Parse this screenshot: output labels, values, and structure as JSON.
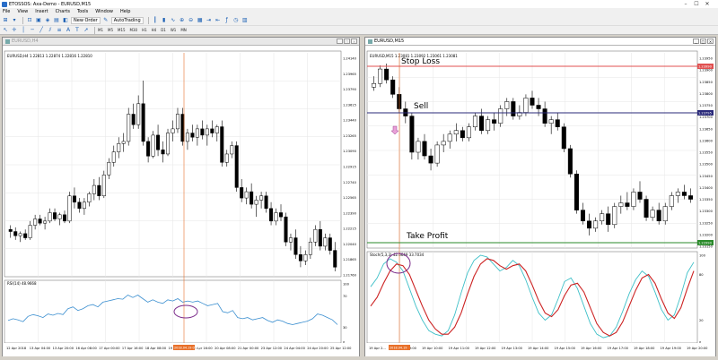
{
  "window": {
    "title": "ETOSSOS: Axa-Demo - EURUSD,M15",
    "min": "–",
    "max": "☐",
    "close": "✕"
  },
  "menu": [
    "File",
    "View",
    "Insert",
    "Charts",
    "Tools",
    "Window",
    "Help"
  ],
  "toolbar": {
    "new_order": "New Order",
    "auto_trading": "AutoTrading"
  },
  "timeframes": [
    "M1",
    "M5",
    "M15",
    "M30",
    "H1",
    "H4",
    "D1",
    "W1",
    "MN"
  ],
  "left_chart": {
    "tab": "EURUSD,H4",
    "info": "EURUSD,H4 1.22813 1.22874 1.22816 1.22810",
    "price_labels": [
      "1.24140",
      "1.23965",
      "1.23790",
      "1.23615",
      "1.23440",
      "1.23265",
      "1.23090",
      "1.22915",
      "1.22740",
      "1.22565",
      "1.22390",
      "1.22215",
      "1.22040",
      "1.21865",
      "1.21760"
    ],
    "indicator_label": "RSI(14) 48.9668",
    "indicator_scale": [
      "100",
      "70",
      "30",
      "0"
    ],
    "time_labels": [
      "12 Apr 2018",
      "13 Apr 04:00",
      "13 Apr 20:00",
      "16 Apr 08:00",
      "17 Apr 00:00",
      "17 Apr 16:00",
      "18 Apr 08:00",
      "19 Apr 00:00",
      "19 Apr 16:00",
      "20 Apr 08:00",
      "21 Apr 00:00",
      "23 Apr 12:00",
      "24 Apr 04:00",
      "24 Apr 20:00",
      "25 Apr 12:00"
    ],
    "cursor_time": "2018.04.19 08:00"
  },
  "right_chart": {
    "tab": "EURUSD,M15",
    "info": "EURUSD,M15 1.23081 1.23092 1.23061 1.23081",
    "stop_loss": "Stop Loss",
    "sell": "Sell",
    "take_profit": "Take Profit",
    "stop_price": "1.23990",
    "sell_price": "1.23795",
    "tp_price": "1.22990",
    "price_labels": [
      "1.23950",
      "1.23900",
      "1.23850",
      "1.23800",
      "1.23750",
      "1.23700",
      "1.23650",
      "1.23600",
      "1.23550",
      "1.23500",
      "1.23450",
      "1.23400",
      "1.23350",
      "1.23300",
      "1.23250",
      "1.23200",
      "1.23150"
    ],
    "indicator_label": "Stoch(5,3,3) 42.6649 33.7034",
    "indicator_scale": [
      "100",
      "80",
      "20",
      "0"
    ],
    "time_labels": [
      "19 Apr 2...",
      "19 Apr 09:00",
      "19 Apr 10:00",
      "19 Apr 11:00",
      "19 Apr 12:00",
      "19 Apr 13:00",
      "19 Apr 14:00",
      "19 Apr 15:00",
      "19 Apr 16:00",
      "19 Apr 17:00",
      "19 Apr 18:00",
      "19 Apr 19:00",
      "19 Apr 20:00"
    ],
    "cursor_time": "2018.04.19"
  },
  "colors": {
    "bull": "#ffffff",
    "bear": "#000000",
    "rsi": "#3b8fd0",
    "stoch_main": "#3ec0c8",
    "stoch_signal": "#cc2222",
    "cursor": "#e8702a",
    "stop_line": "#e05050",
    "sell_line": "#2a2a7a",
    "tp_line": "#2a8a2a",
    "ellipse": "#7a2a8a"
  },
  "chart_data": [
    {
      "type": "candlestick",
      "title": "EURUSD,H4",
      "ohlc": [
        [
          0.2,
          0.22,
          0.16,
          0.19
        ],
        [
          0.19,
          0.21,
          0.15,
          0.17
        ],
        [
          0.17,
          0.19,
          0.14,
          0.18
        ],
        [
          0.18,
          0.2,
          0.15,
          0.16
        ],
        [
          0.16,
          0.24,
          0.15,
          0.22
        ],
        [
          0.22,
          0.27,
          0.2,
          0.25
        ],
        [
          0.25,
          0.27,
          0.22,
          0.23
        ],
        [
          0.23,
          0.26,
          0.2,
          0.24
        ],
        [
          0.24,
          0.3,
          0.23,
          0.28
        ],
        [
          0.28,
          0.3,
          0.24,
          0.25
        ],
        [
          0.25,
          0.28,
          0.22,
          0.27
        ],
        [
          0.27,
          0.29,
          0.23,
          0.24
        ],
        [
          0.24,
          0.38,
          0.23,
          0.36
        ],
        [
          0.36,
          0.4,
          0.3,
          0.33
        ],
        [
          0.33,
          0.35,
          0.28,
          0.3
        ],
        [
          0.3,
          0.35,
          0.27,
          0.33
        ],
        [
          0.33,
          0.38,
          0.31,
          0.37
        ],
        [
          0.37,
          0.44,
          0.34,
          0.41
        ],
        [
          0.41,
          0.45,
          0.34,
          0.36
        ],
        [
          0.36,
          0.48,
          0.35,
          0.46
        ],
        [
          0.46,
          0.54,
          0.44,
          0.52
        ],
        [
          0.52,
          0.6,
          0.5,
          0.57
        ],
        [
          0.57,
          0.64,
          0.54,
          0.61
        ],
        [
          0.61,
          0.66,
          0.57,
          0.62
        ],
        [
          0.62,
          0.78,
          0.6,
          0.75
        ],
        [
          0.75,
          0.8,
          0.68,
          0.7
        ],
        [
          0.7,
          0.84,
          0.68,
          0.8
        ],
        [
          0.8,
          0.91,
          0.6,
          0.62
        ],
        [
          0.62,
          0.64,
          0.52,
          0.55
        ],
        [
          0.55,
          0.67,
          0.54,
          0.65
        ],
        [
          0.65,
          0.7,
          0.55,
          0.58
        ],
        [
          0.58,
          0.62,
          0.52,
          0.56
        ],
        [
          0.56,
          0.68,
          0.55,
          0.66
        ],
        [
          0.66,
          0.72,
          0.62,
          0.68
        ],
        [
          0.68,
          0.78,
          0.66,
          0.75
        ],
        [
          0.75,
          0.78,
          0.6,
          0.62
        ],
        [
          0.62,
          0.68,
          0.58,
          0.66
        ],
        [
          0.66,
          0.7,
          0.62,
          0.64
        ],
        [
          0.64,
          0.7,
          0.6,
          0.68
        ],
        [
          0.68,
          0.72,
          0.63,
          0.65
        ],
        [
          0.65,
          0.7,
          0.6,
          0.68
        ],
        [
          0.68,
          0.72,
          0.64,
          0.66
        ],
        [
          0.66,
          0.7,
          0.62,
          0.69
        ],
        [
          0.69,
          0.72,
          0.5,
          0.52
        ],
        [
          0.52,
          0.58,
          0.5,
          0.56
        ],
        [
          0.56,
          0.62,
          0.54,
          0.6
        ],
        [
          0.6,
          0.62,
          0.38,
          0.4
        ],
        [
          0.4,
          0.44,
          0.33,
          0.35
        ],
        [
          0.35,
          0.4,
          0.32,
          0.38
        ],
        [
          0.38,
          0.42,
          0.3,
          0.32
        ],
        [
          0.32,
          0.36,
          0.26,
          0.34
        ],
        [
          0.34,
          0.38,
          0.3,
          0.36
        ],
        [
          0.36,
          0.38,
          0.28,
          0.3
        ],
        [
          0.3,
          0.33,
          0.22,
          0.24
        ],
        [
          0.24,
          0.3,
          0.22,
          0.28
        ],
        [
          0.28,
          0.32,
          0.24,
          0.26
        ],
        [
          0.26,
          0.28,
          0.12,
          0.14
        ],
        [
          0.14,
          0.18,
          0.1,
          0.16
        ],
        [
          0.16,
          0.2,
          0.06,
          0.08
        ],
        [
          0.08,
          0.12,
          0.02,
          0.05
        ],
        [
          0.05,
          0.1,
          0.03,
          0.08
        ],
        [
          0.08,
          0.16,
          0.06,
          0.14
        ],
        [
          0.14,
          0.22,
          0.12,
          0.2
        ],
        [
          0.2,
          0.24,
          0.1,
          0.12
        ],
        [
          0.12,
          0.18,
          0.1,
          0.16
        ],
        [
          0.16,
          0.18,
          0.08,
          0.1
        ],
        [
          0.1,
          0.14,
          0.0,
          0.02
        ]
      ],
      "rsi": [
        0.35,
        0.38,
        0.36,
        0.33,
        0.42,
        0.45,
        0.43,
        0.4,
        0.46,
        0.44,
        0.47,
        0.45,
        0.55,
        0.58,
        0.52,
        0.55,
        0.6,
        0.62,
        0.58,
        0.66,
        0.68,
        0.7,
        0.72,
        0.71,
        0.78,
        0.74,
        0.78,
        0.72,
        0.66,
        0.7,
        0.66,
        0.64,
        0.7,
        0.68,
        0.72,
        0.66,
        0.68,
        0.66,
        0.68,
        0.64,
        0.6,
        0.62,
        0.64,
        0.5,
        0.48,
        0.52,
        0.4,
        0.38,
        0.4,
        0.36,
        0.38,
        0.4,
        0.35,
        0.32,
        0.36,
        0.34,
        0.3,
        0.28,
        0.3,
        0.32,
        0.34,
        0.38,
        0.46,
        0.44,
        0.4,
        0.36,
        0.28
      ]
    },
    {
      "type": "candlestick",
      "title": "EURUSD,M15",
      "ohlc": [
        [
          0.86,
          0.92,
          0.84,
          0.88
        ],
        [
          0.88,
          0.98,
          0.86,
          0.96
        ],
        [
          0.96,
          0.99,
          0.88,
          0.9
        ],
        [
          0.9,
          0.92,
          0.8,
          0.82
        ],
        [
          0.82,
          0.86,
          0.72,
          0.74
        ],
        [
          0.74,
          0.78,
          0.66,
          0.7
        ],
        [
          0.7,
          0.72,
          0.46,
          0.5
        ],
        [
          0.5,
          0.58,
          0.46,
          0.56
        ],
        [
          0.56,
          0.6,
          0.46,
          0.48
        ],
        [
          0.48,
          0.52,
          0.4,
          0.44
        ],
        [
          0.44,
          0.56,
          0.42,
          0.54
        ],
        [
          0.54,
          0.6,
          0.5,
          0.56
        ],
        [
          0.56,
          0.62,
          0.52,
          0.6
        ],
        [
          0.6,
          0.66,
          0.56,
          0.62
        ],
        [
          0.62,
          0.64,
          0.56,
          0.58
        ],
        [
          0.58,
          0.66,
          0.56,
          0.64
        ],
        [
          0.64,
          0.72,
          0.62,
          0.7
        ],
        [
          0.7,
          0.74,
          0.6,
          0.62
        ],
        [
          0.62,
          0.7,
          0.6,
          0.68
        ],
        [
          0.68,
          0.72,
          0.62,
          0.66
        ],
        [
          0.66,
          0.76,
          0.64,
          0.74
        ],
        [
          0.74,
          0.8,
          0.7,
          0.78
        ],
        [
          0.78,
          0.8,
          0.68,
          0.7
        ],
        [
          0.7,
          0.76,
          0.68,
          0.72
        ],
        [
          0.72,
          0.82,
          0.7,
          0.8
        ],
        [
          0.8,
          0.84,
          0.74,
          0.76
        ],
        [
          0.76,
          0.8,
          0.7,
          0.74
        ],
        [
          0.74,
          0.78,
          0.64,
          0.66
        ],
        [
          0.66,
          0.7,
          0.6,
          0.68
        ],
        [
          0.68,
          0.72,
          0.62,
          0.64
        ],
        [
          0.64,
          0.66,
          0.5,
          0.52
        ],
        [
          0.52,
          0.54,
          0.36,
          0.38
        ],
        [
          0.38,
          0.4,
          0.16,
          0.18
        ],
        [
          0.18,
          0.22,
          0.1,
          0.12
        ],
        [
          0.12,
          0.16,
          0.04,
          0.08
        ],
        [
          0.08,
          0.14,
          0.06,
          0.12
        ],
        [
          0.12,
          0.18,
          0.1,
          0.16
        ],
        [
          0.16,
          0.2,
          0.06,
          0.1
        ],
        [
          0.1,
          0.22,
          0.08,
          0.2
        ],
        [
          0.2,
          0.26,
          0.16,
          0.22
        ],
        [
          0.22,
          0.28,
          0.18,
          0.2
        ],
        [
          0.2,
          0.3,
          0.18,
          0.28
        ],
        [
          0.28,
          0.34,
          0.22,
          0.24
        ],
        [
          0.24,
          0.26,
          0.12,
          0.14
        ],
        [
          0.14,
          0.2,
          0.12,
          0.18
        ],
        [
          0.18,
          0.22,
          0.1,
          0.12
        ],
        [
          0.12,
          0.22,
          0.1,
          0.2
        ],
        [
          0.2,
          0.28,
          0.18,
          0.26
        ],
        [
          0.26,
          0.3,
          0.22,
          0.28
        ],
        [
          0.28,
          0.32,
          0.24,
          0.26
        ],
        [
          0.26,
          0.3,
          0.22,
          0.24
        ]
      ],
      "stoch_main": [
        0.62,
        0.72,
        0.88,
        0.94,
        0.9,
        0.8,
        0.6,
        0.4,
        0.24,
        0.12,
        0.08,
        0.06,
        0.12,
        0.3,
        0.55,
        0.78,
        0.92,
        0.98,
        0.96,
        0.88,
        0.8,
        0.84,
        0.92,
        0.86,
        0.7,
        0.5,
        0.32,
        0.24,
        0.3,
        0.48,
        0.68,
        0.72,
        0.6,
        0.4,
        0.2,
        0.08,
        0.04,
        0.06,
        0.16,
        0.34,
        0.54,
        0.7,
        0.8,
        0.74,
        0.56,
        0.36,
        0.24,
        0.3,
        0.52,
        0.78,
        0.9
      ],
      "stoch_signal": [
        0.4,
        0.5,
        0.66,
        0.8,
        0.88,
        0.86,
        0.76,
        0.58,
        0.4,
        0.24,
        0.14,
        0.08,
        0.08,
        0.16,
        0.32,
        0.54,
        0.74,
        0.88,
        0.94,
        0.92,
        0.86,
        0.82,
        0.86,
        0.88,
        0.8,
        0.64,
        0.46,
        0.32,
        0.28,
        0.36,
        0.52,
        0.64,
        0.66,
        0.56,
        0.38,
        0.2,
        0.1,
        0.06,
        0.1,
        0.22,
        0.4,
        0.58,
        0.72,
        0.76,
        0.66,
        0.48,
        0.32,
        0.26,
        0.38,
        0.6,
        0.8
      ]
    }
  ]
}
